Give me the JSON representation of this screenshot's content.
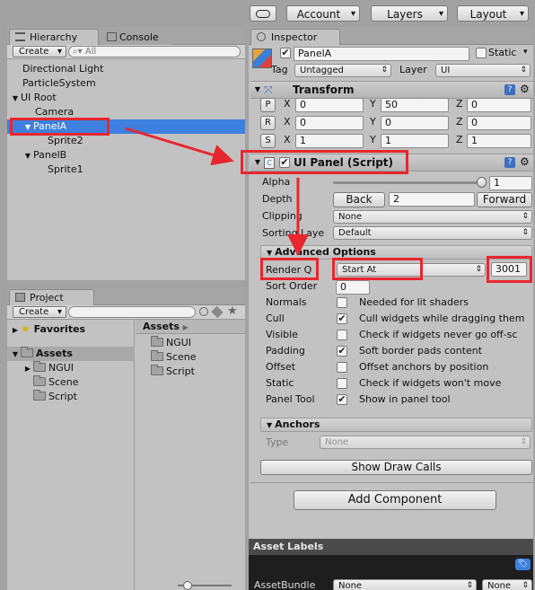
{
  "toolbar": {
    "account_label": "Account",
    "layers_label": "Layers",
    "layout_label": "Layout"
  },
  "hierarchy": {
    "tab_label": "Hierarchy",
    "console_tab_label": "Console",
    "create_label": "Create",
    "search_placeholder": "All",
    "items": [
      {
        "label": "Directional Light"
      },
      {
        "label": "ParticleSystem"
      },
      {
        "label": "UI Root"
      },
      {
        "label": "Camera"
      },
      {
        "label": "PanelA"
      },
      {
        "label": "Sprite2"
      },
      {
        "label": "PanelB"
      },
      {
        "label": "Sprite1"
      }
    ]
  },
  "project": {
    "tab_label": "Project",
    "create_label": "Create",
    "favorites_label": "Favorites",
    "assets_label": "Assets",
    "tree_children": [
      "NGUI",
      "Scene",
      "Script"
    ],
    "breadcrumb": "Assets",
    "contents": [
      "NGUI",
      "Scene",
      "Script"
    ]
  },
  "inspector": {
    "tab_label": "Inspector",
    "object_name": "PanelA",
    "static_label": "Static",
    "tag_label": "Tag",
    "tag_value": "Untagged",
    "layer_label": "Layer",
    "layer_value": "UI",
    "transform": {
      "title": "Transform",
      "rows": [
        {
          "btn": "P",
          "x": "0",
          "y": "50",
          "z": "0"
        },
        {
          "btn": "R",
          "x": "0",
          "y": "0",
          "z": "0"
        },
        {
          "btn": "S",
          "x": "1",
          "y": "1",
          "z": "1"
        }
      ],
      "axis_x": "X",
      "axis_y": "Y",
      "axis_z": "Z"
    },
    "uipanel": {
      "title": "UI Panel (Script)",
      "alpha_label": "Alpha",
      "alpha_value": "1",
      "alpha_fraction": 1.0,
      "depth_label": "Depth",
      "back_label": "Back",
      "depth_value": "2",
      "forward_label": "Forward",
      "clipping_label": "Clipping",
      "clipping_value": "None",
      "sorting_label": "Sorting Laye",
      "sorting_value": "Default",
      "advanced_title": "Advanced Options",
      "render_q_label": "Render Q",
      "render_q_mode": "Start At",
      "render_q_value": "3001",
      "sort_order_label": "Sort Order",
      "sort_order_value": "0",
      "options": [
        {
          "label": "Normals",
          "checked": false,
          "desc": "Needed for lit shaders"
        },
        {
          "label": "Cull",
          "checked": true,
          "desc": "Cull widgets while dragging them"
        },
        {
          "label": "Visible",
          "checked": false,
          "desc": "Check if widgets never go off-sc"
        },
        {
          "label": "Padding",
          "checked": true,
          "desc": "Soft border pads content"
        },
        {
          "label": "Offset",
          "checked": false,
          "desc": "Offset anchors by position"
        },
        {
          "label": "Static",
          "checked": false,
          "desc": "Check if widgets won't move"
        },
        {
          "label": "Panel Tool",
          "checked": true,
          "desc": "Show in panel tool"
        }
      ],
      "anchors_title": "Anchors",
      "type_label": "Type",
      "type_value": "None",
      "show_draw_calls_label": "Show Draw Calls"
    },
    "add_component_label": "Add Component",
    "asset_labels_title": "Asset Labels",
    "asset_bundle_label": "AssetBundle",
    "asset_bundle_value": "None",
    "asset_variant_value": "None"
  },
  "colors": {
    "selection": "#3d80df",
    "annotation": "#e8262e"
  }
}
